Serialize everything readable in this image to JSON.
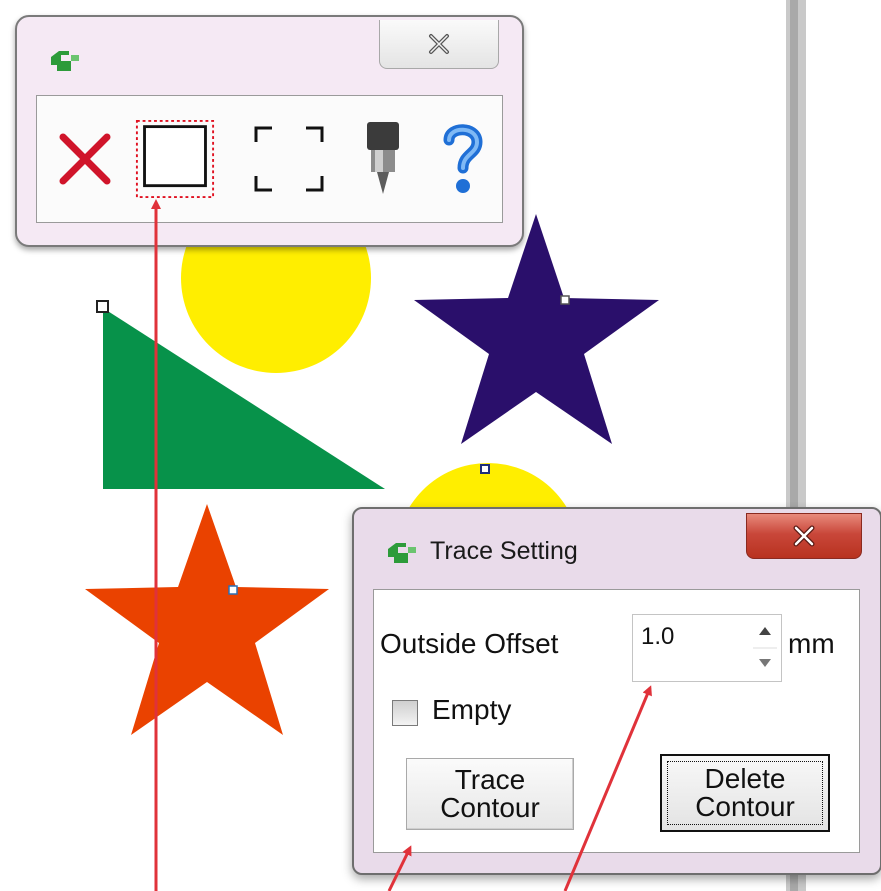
{
  "toolbar": {
    "tools": [
      {
        "name": "delete-tool",
        "icon": "red-x-icon"
      },
      {
        "name": "rectangle-tool",
        "icon": "solid-rectangle-icon"
      },
      {
        "name": "dashed-frame-tool",
        "icon": "dashed-rectangle-icon"
      },
      {
        "name": "cutter-tool",
        "icon": "blade-holder-icon"
      },
      {
        "name": "help-tool",
        "icon": "question-mark-icon"
      }
    ]
  },
  "trace_setting": {
    "title": "Trace Setting",
    "outside_offset_label": "Outside Offset",
    "outside_offset_value": "1.0",
    "unit": "mm",
    "empty_label": "Empty",
    "empty_checked": false,
    "trace_contour_line1": "Trace",
    "trace_contour_line2": "Contour",
    "delete_contour_line1": "Delete",
    "delete_contour_line2": "Contour"
  },
  "colors": {
    "yellow": "#ffee00",
    "green": "#07924a",
    "purple": "#2a0f6b",
    "orange": "#ea4200",
    "arrow_red": "#e0323a",
    "close_red": "#c9473a"
  }
}
